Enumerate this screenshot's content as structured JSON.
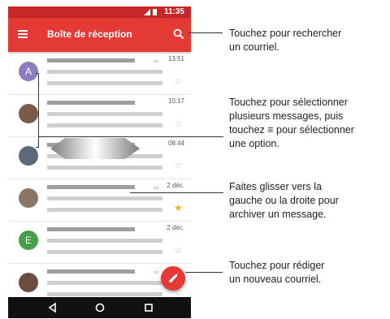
{
  "status": {
    "time": "11:35"
  },
  "app": {
    "title": "Boîte de réception"
  },
  "emails": [
    {
      "avatar_letter": "A",
      "avatar_color": "#8e7cc3",
      "time": "13:51",
      "starred": false,
      "attachment": true
    },
    {
      "avatar_letter": "",
      "avatar_color": "#7a5a48",
      "time": "10:17",
      "starred": false,
      "attachment": false
    },
    {
      "avatar_letter": "",
      "avatar_color": "#5a6a7a",
      "time": "08:44",
      "starred": false,
      "attachment": false
    },
    {
      "avatar_letter": "",
      "avatar_color": "#8a7664",
      "time": "2 déc.",
      "starred": true,
      "attachment": true
    },
    {
      "avatar_letter": "E",
      "avatar_color": "#43a047",
      "time": "2 déc.",
      "starred": false,
      "attachment": false
    },
    {
      "avatar_letter": "",
      "avatar_color": "#6d4c41",
      "time": "",
      "starred": false,
      "attachment": true
    }
  ],
  "callouts": {
    "search": [
      "Touchez pour rechercher",
      "un courriel."
    ],
    "select": [
      "Touchez pour sélectionner",
      "plusieurs messages, puis",
      "touchez ≡ pour sélectionner",
      "une option."
    ],
    "swipe": [
      "Faites glisser vers la",
      "gauche ou la droite pour",
      "archiver un message."
    ],
    "compose": [
      "Touchez pour rédiger",
      "un nouveau courriel."
    ]
  },
  "colors": {
    "appbar": "#e53935",
    "statusbar": "#c62828",
    "fab": "#e53935",
    "star": "#f5b400"
  }
}
